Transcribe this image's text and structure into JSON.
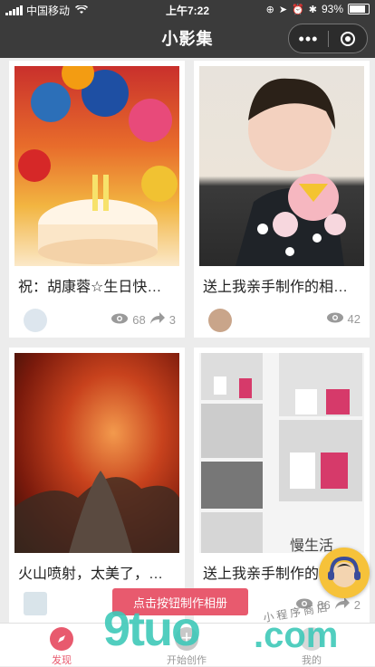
{
  "status": {
    "carrier": "中国移动",
    "time": "上午7:22",
    "battery": "93%"
  },
  "nav": {
    "title": "小影集",
    "more_icon": "more-dots-icon",
    "close_icon": "target-icon"
  },
  "cards": [
    {
      "title": "祝：胡康蓉☆生日快…",
      "views": "68",
      "shares": "3"
    },
    {
      "title": "送上我亲手制作的相…",
      "views": "42"
    },
    {
      "title": "火山喷射，太美了，…"
    },
    {
      "title": "送上我亲手制作的…",
      "views": "86",
      "shares": "2"
    }
  ],
  "banner": "点击按钮制作相册",
  "tabs": [
    {
      "label": "发现",
      "icon": "compass-icon"
    },
    {
      "label": "开始创作",
      "icon": "plus-icon"
    },
    {
      "label": "我的",
      "icon": "user-icon"
    }
  ],
  "watermark": {
    "left": "9tuo",
    "right": ".com",
    "subtitle": "小 程 序 商 店"
  }
}
